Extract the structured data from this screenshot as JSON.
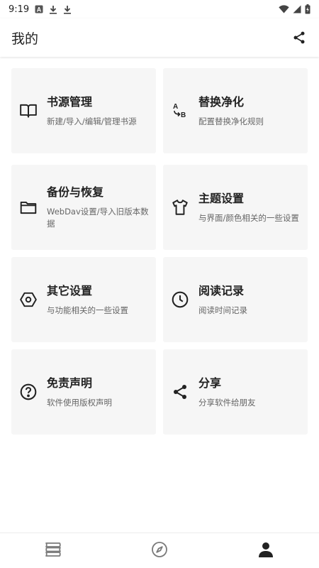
{
  "status_bar": {
    "time": "9:19",
    "icons": [
      "font-notification-icon",
      "download-icon",
      "download-icon",
      "wifi-icon",
      "signal-icon",
      "battery-charging-icon"
    ]
  },
  "app_bar": {
    "title": "我的",
    "action_icon": "share-icon"
  },
  "cards": [
    {
      "icon": "book-icon",
      "title": "书源管理",
      "desc": "新建/导入/编辑/管理书源"
    },
    {
      "icon": "replace-ab-icon",
      "title": "替换净化",
      "desc": "配置替换净化规则"
    },
    {
      "icon": "folder-icon",
      "title": "备份与恢复",
      "desc": "WebDav设置/导入旧版本数据"
    },
    {
      "icon": "shirt-icon",
      "title": "主题设置",
      "desc": "与界面/颜色相关的一些设置"
    },
    {
      "icon": "hexagon-settings-icon",
      "title": "其它设置",
      "desc": "与功能相关的一些设置"
    },
    {
      "icon": "clock-icon",
      "title": "阅读记录",
      "desc": "阅读时间记录"
    },
    {
      "icon": "help-circle-icon",
      "title": "免责声明",
      "desc": "软件使用版权声明"
    },
    {
      "icon": "share-icon",
      "title": "分享",
      "desc": "分享软件给朋友"
    }
  ],
  "bottom_nav": {
    "items": [
      {
        "icon": "bookshelf-icon",
        "active": false
      },
      {
        "icon": "compass-icon",
        "active": false
      },
      {
        "icon": "person-icon",
        "active": true
      }
    ],
    "active_color": "#222222",
    "inactive_color": "#7a7a7a"
  },
  "colors": {
    "card_bg": "#f6f6f6",
    "text_primary": "#222222",
    "text_secondary": "#666666"
  }
}
